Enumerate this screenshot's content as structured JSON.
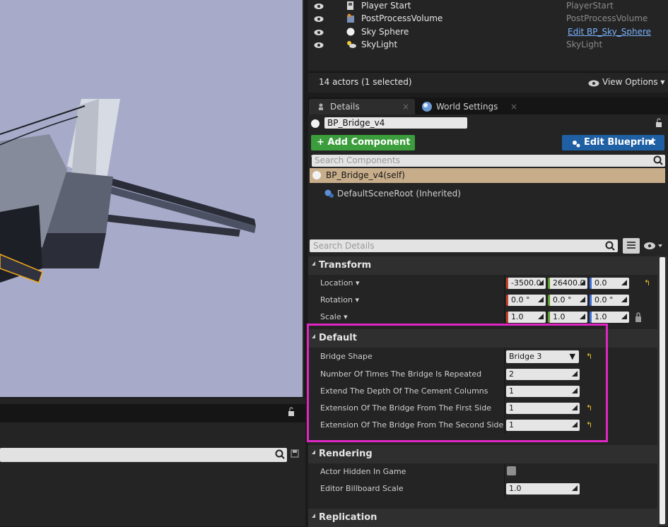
{
  "outliner": {
    "rows": [
      {
        "name": "Player Start",
        "type": "PlayerStart",
        "icon": "player-start-icon"
      },
      {
        "name": "PostProcessVolume",
        "type": "PostProcessVolume",
        "icon": "postprocess-volume-icon"
      },
      {
        "name": "Sky Sphere",
        "type": "Edit BP_Sky_Sphere",
        "icon": "sky-sphere-icon"
      },
      {
        "name": "SkyLight",
        "type": "SkyLight",
        "icon": "skylight-icon"
      }
    ],
    "status": "14 actors (1 selected)",
    "view_options": "View Options"
  },
  "tabs": {
    "details": "Details",
    "world_settings": "World Settings",
    "close": "×"
  },
  "actor": {
    "name": "BP_Bridge_v4"
  },
  "buttons": {
    "add_component": "+ Add Component",
    "edit_blueprint": "Edit Blueprint"
  },
  "components": {
    "search_placeholder": "Search Components",
    "self": "BP_Bridge_v4(self)",
    "root": "DefaultSceneRoot (Inherited)"
  },
  "details": {
    "search_placeholder": "Search Details"
  },
  "transform": {
    "title": "Transform",
    "location_label": "Location",
    "rotation_label": "Rotation",
    "scale_label": "Scale",
    "location": [
      "-3500.0",
      "26400.0",
      "0.0"
    ],
    "rotation": [
      "0.0 °",
      "0.0 °",
      "0.0 °"
    ],
    "scale": [
      "1.0",
      "1.0",
      "1.0"
    ]
  },
  "default": {
    "title": "Default",
    "bridge_shape_label": "Bridge Shape",
    "bridge_shape_value": "Bridge 3",
    "repeat_label": "Number Of Times The Bridge Is Repeated",
    "repeat_value": "2",
    "depth_label": "Extend The Depth Of The Cement Columns",
    "depth_value": "1",
    "first_side_label": "Extension Of The Bridge From The First Side",
    "first_side_value": "1",
    "second_side_label": "Extension Of The Bridge From The Second Side",
    "second_side_value": "1"
  },
  "rendering": {
    "title": "Rendering",
    "hidden_label": "Actor Hidden In Game",
    "billboard_label": "Editor Billboard Scale",
    "billboard_value": "1.0"
  },
  "replication": {
    "title": "Replication"
  },
  "colors": {
    "highlight": "#e026c3",
    "add_component": "#3b9d3b",
    "edit_blueprint": "#1f5fa3",
    "selected_component": "#c8ad8a"
  }
}
